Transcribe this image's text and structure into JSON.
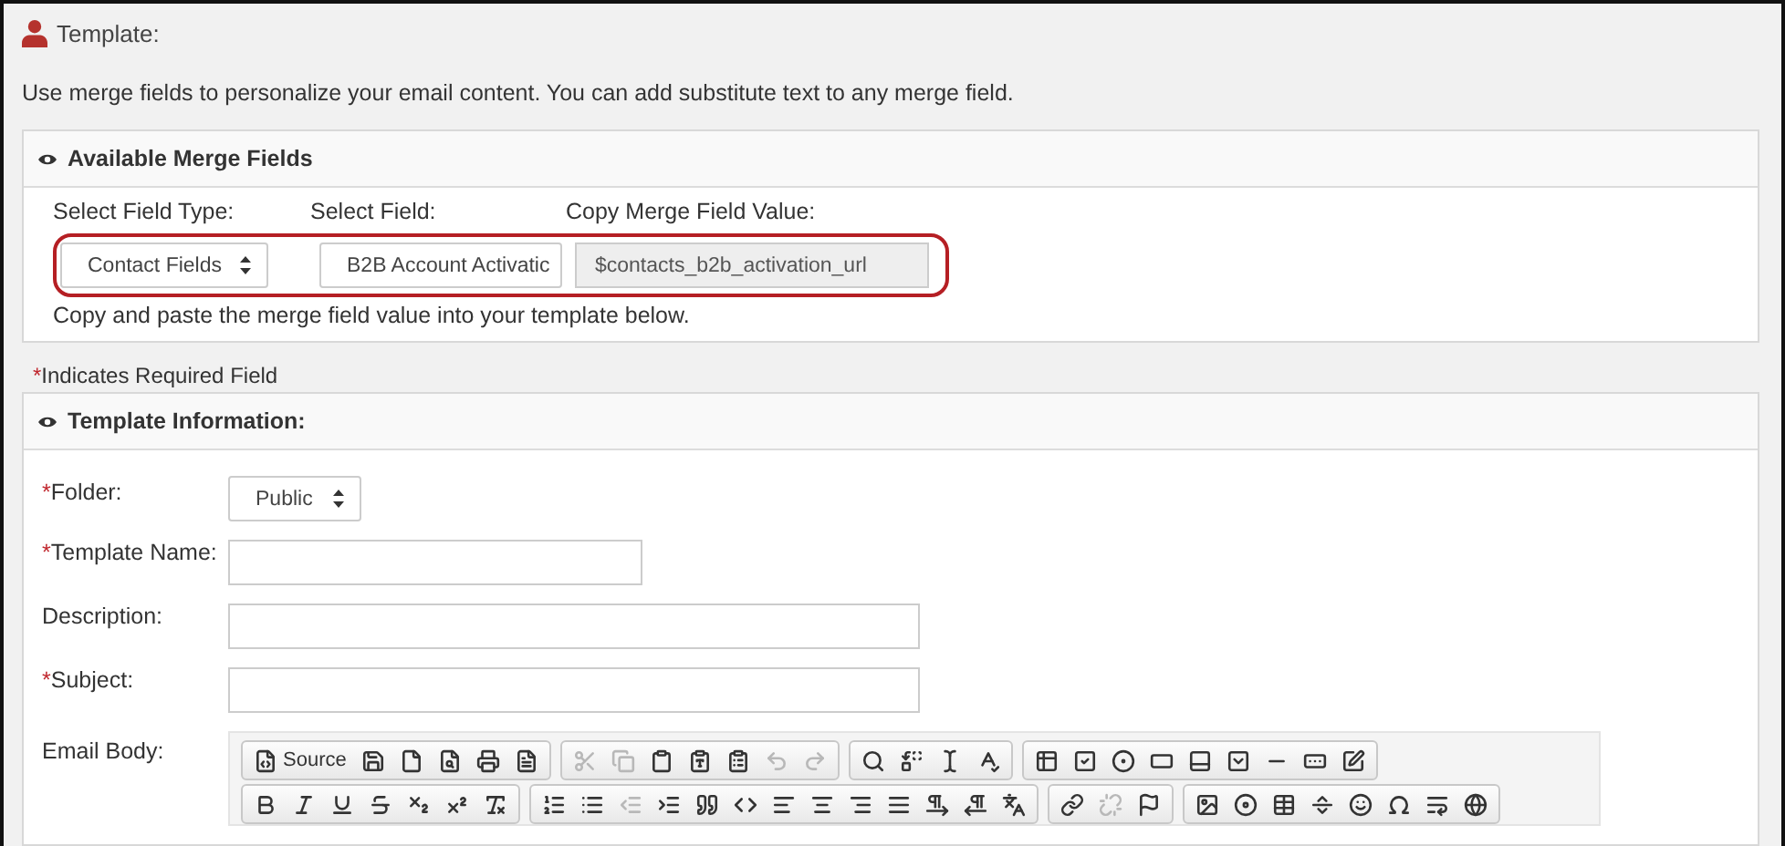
{
  "header": {
    "title": "Template:"
  },
  "intro": "Use merge fields to personalize your email content. You can add substitute text to any merge field.",
  "merge_panel": {
    "title": "Available Merge Fields",
    "columns": [
      {
        "label": "Select Field Type:",
        "kind": "select",
        "value": "Contact Fields"
      },
      {
        "label": "Select Field:",
        "kind": "select",
        "value": "B2B Account Activatic"
      },
      {
        "label": "Copy Merge Field Value:",
        "kind": "readonly",
        "value": "$contacts_b2b_activation_url"
      }
    ],
    "hint": "Copy and paste the merge field value into your template below."
  },
  "required_note": {
    "mark": "*",
    "text": "Indicates Required Field"
  },
  "info_panel": {
    "title": "Template Information:",
    "fields": [
      {
        "label": "Folder:",
        "required": true,
        "kind": "select",
        "value": "Public"
      },
      {
        "label": "Template Name:",
        "required": true,
        "kind": "short_text"
      },
      {
        "label": "Description:",
        "required": false,
        "kind": "text"
      },
      {
        "label": "Subject:",
        "required": true,
        "kind": "text"
      },
      {
        "label": "Email Body:",
        "required": false,
        "kind": "editor"
      }
    ]
  },
  "toolbar": [
    [
      [
        {
          "label": "Source",
          "disabled": false
        },
        {
          "disabled": false
        },
        {
          "disabled": false
        },
        {
          "disabled": false
        },
        {
          "disabled": false
        },
        {
          "disabled": false
        }
      ],
      [
        {
          "disabled": true
        },
        {
          "disabled": true
        },
        {
          "disabled": false
        },
        {
          "disabled": false
        },
        {
          "disabled": false
        },
        {
          "disabled": true
        },
        {
          "disabled": true
        }
      ],
      [
        {
          "disabled": false
        },
        {
          "disabled": false
        },
        {
          "disabled": false
        },
        {
          "disabled": false
        }
      ],
      [
        {
          "disabled": false
        },
        {
          "disabled": false
        },
        {
          "disabled": false
        },
        {
          "disabled": false
        },
        {
          "disabled": false
        },
        {
          "disabled": false
        },
        {
          "disabled": false
        },
        {
          "disabled": false
        },
        {
          "disabled": false
        }
      ]
    ],
    [
      [
        {
          "disabled": false
        },
        {
          "disabled": false
        },
        {
          "disabled": false
        },
        {
          "disabled": false
        },
        {
          "disabled": false
        },
        {
          "disabled": false
        },
        {
          "disabled": false
        }
      ],
      [
        {
          "disabled": false
        },
        {
          "disabled": false
        },
        {
          "disabled": true
        },
        {
          "disabled": false
        },
        {
          "disabled": false
        },
        {
          "disabled": false
        },
        {
          "disabled": false
        },
        {
          "disabled": false
        },
        {
          "disabled": false
        },
        {
          "disabled": false
        },
        {
          "disabled": false
        },
        {
          "disabled": false
        },
        {
          "disabled": false
        }
      ],
      [
        {
          "disabled": false
        },
        {
          "disabled": true
        },
        {
          "disabled": false
        }
      ],
      [
        {
          "disabled": false
        },
        {
          "disabled": false
        },
        {
          "disabled": false
        },
        {
          "disabled": false
        },
        {
          "disabled": false
        },
        {
          "disabled": false
        },
        {
          "disabled": false
        },
        {
          "disabled": false
        }
      ]
    ]
  ]
}
